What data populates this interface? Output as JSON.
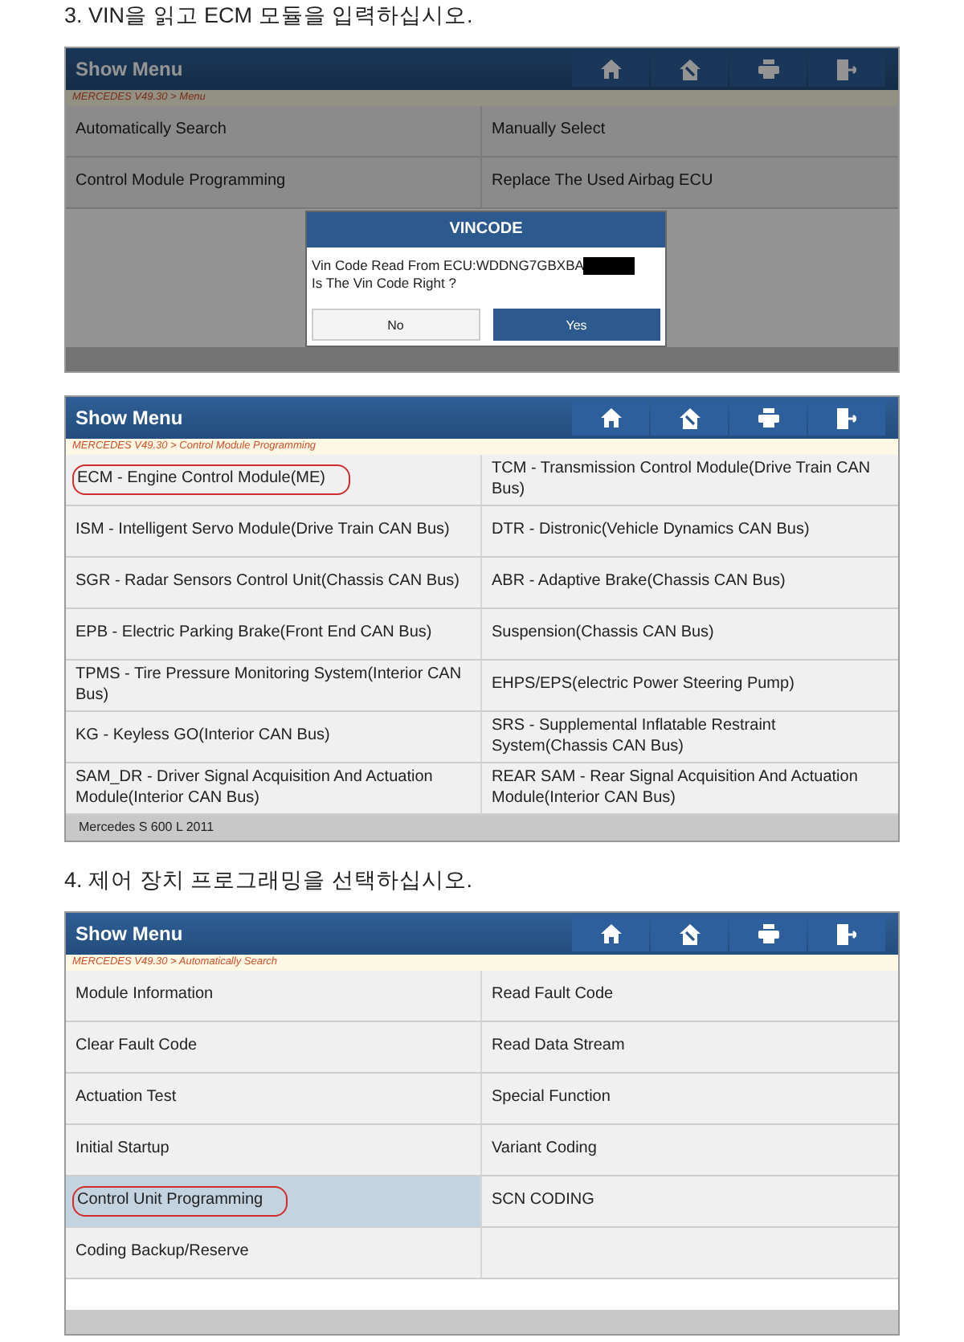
{
  "sections": [
    {
      "heading": "3. VIN을 읽고 ECM 모듈을 입력하십시오.",
      "screen": {
        "title": "Show Menu",
        "dimmed": true,
        "breadcrumb": "MERCEDES V49.30 > Menu",
        "items": [
          {
            "label": "Automatically Search",
            "selected": false,
            "highlighted": false
          },
          {
            "label": "Manually Select",
            "selected": false,
            "highlighted": false
          },
          {
            "label": "Control Module Programming",
            "selected": false,
            "highlighted": false
          },
          {
            "label": "Replace The Used Airbag ECU",
            "selected": false,
            "highlighted": false
          }
        ],
        "dialog": {
          "title": "VINCODE",
          "lines": [
            "Vin Code Read From ECU:WDDNG7GBXBA",
            "Is The Vin Code Right ?"
          ],
          "redacted": true,
          "buttons": [
            {
              "label": "No",
              "primary": false
            },
            {
              "label": "Yes",
              "primary": true
            }
          ]
        }
      }
    },
    {
      "screen": {
        "title": "Show Menu",
        "breadcrumb": "MERCEDES V49.30 > Control Module Programming",
        "items": [
          {
            "label": "ECM - Engine Control Module(ME)",
            "selected": false,
            "highlighted": true
          },
          {
            "label": "TCM - Transmission Control Module(Drive Train CAN Bus)",
            "selected": false,
            "highlighted": false
          },
          {
            "label": "ISM - Intelligent Servo Module(Drive Train CAN Bus)",
            "selected": false,
            "highlighted": false
          },
          {
            "label": "DTR - Distronic(Vehicle Dynamics CAN Bus)",
            "selected": false,
            "highlighted": false
          },
          {
            "label": "SGR - Radar Sensors Control Unit(Chassis CAN Bus)",
            "selected": false,
            "highlighted": false
          },
          {
            "label": "ABR - Adaptive Brake(Chassis CAN Bus)",
            "selected": false,
            "highlighted": false
          },
          {
            "label": "EPB - Electric Parking Brake(Front End CAN Bus)",
            "selected": false,
            "highlighted": false
          },
          {
            "label": "Suspension(Chassis CAN Bus)",
            "selected": false,
            "highlighted": false
          },
          {
            "label": "TPMS - Tire Pressure Monitoring System(Interior CAN Bus)",
            "selected": false,
            "highlighted": false
          },
          {
            "label": "EHPS/EPS(electric Power Steering Pump)",
            "selected": false,
            "highlighted": false
          },
          {
            "label": "KG - Keyless GO(Interior CAN Bus)",
            "selected": false,
            "highlighted": false
          },
          {
            "label": "SRS - Supplemental Inflatable Restraint System(Chassis CAN Bus)",
            "selected": false,
            "highlighted": false
          },
          {
            "label": "SAM_DR - Driver Signal Acquisition And Actuation Module(Interior CAN Bus)",
            "selected": false,
            "highlighted": false
          },
          {
            "label": "REAR SAM - Rear Signal Acquisition And Actuation Module(Interior CAN Bus)",
            "selected": false,
            "highlighted": false
          }
        ],
        "footer": "Mercedes S 600 L 2011"
      }
    },
    {
      "heading": "4. 제어 장치 프로그래밍을 선택하십시오.",
      "screen": {
        "title": "Show Menu",
        "breadcrumb": "MERCEDES V49.30 > Automatically Search",
        "items": [
          {
            "label": "Module Information",
            "selected": false,
            "highlighted": false
          },
          {
            "label": "Read Fault Code",
            "selected": false,
            "highlighted": false
          },
          {
            "label": "Clear Fault Code",
            "selected": false,
            "highlighted": false
          },
          {
            "label": "Read Data Stream",
            "selected": false,
            "highlighted": false
          },
          {
            "label": "Actuation Test",
            "selected": false,
            "highlighted": false
          },
          {
            "label": "Special Function",
            "selected": false,
            "highlighted": false
          },
          {
            "label": "Initial Startup",
            "selected": false,
            "highlighted": false
          },
          {
            "label": "Variant Coding",
            "selected": false,
            "highlighted": false
          },
          {
            "label": "Control Unit Programming",
            "selected": true,
            "highlighted": true
          },
          {
            "label": "SCN CODING",
            "selected": false,
            "highlighted": false
          },
          {
            "label": "Coding Backup/Reserve",
            "selected": false,
            "highlighted": false
          }
        ]
      }
    }
  ]
}
